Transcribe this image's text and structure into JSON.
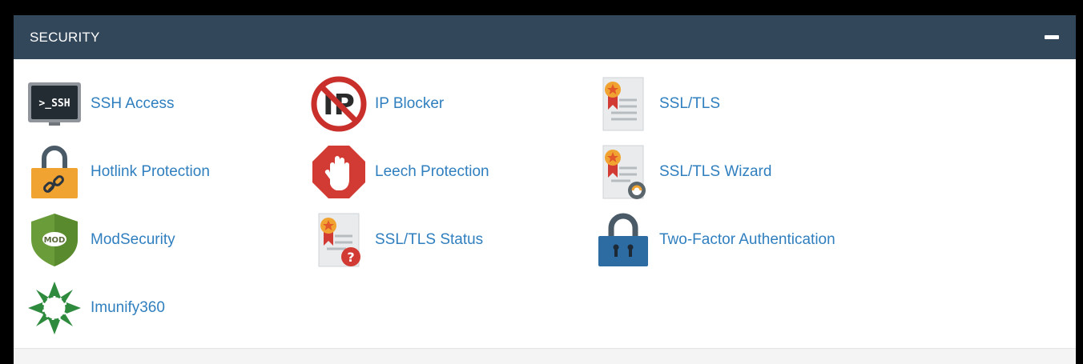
{
  "section": {
    "title": "SECURITY",
    "collapse_icon": "minus-icon"
  },
  "colors": {
    "header_bg": "#33475b",
    "link": "#2f7fbf"
  },
  "items": [
    {
      "label": "SSH Access",
      "icon": "ssh-terminal-icon"
    },
    {
      "label": "IP Blocker",
      "icon": "ip-blocker-icon"
    },
    {
      "label": "SSL/TLS",
      "icon": "certificate-icon"
    },
    {
      "label": "Hotlink Protection",
      "icon": "padlock-link-icon"
    },
    {
      "label": "Leech Protection",
      "icon": "stop-hand-icon"
    },
    {
      "label": "SSL/TLS Wizard",
      "icon": "certificate-wizard-icon"
    },
    {
      "label": "ModSecurity",
      "icon": "mod-shield-icon"
    },
    {
      "label": "SSL/TLS Status",
      "icon": "certificate-status-icon"
    },
    {
      "label": "Two-Factor Authentication",
      "icon": "two-factor-lock-icon"
    },
    {
      "label": "Imunify360",
      "icon": "imunify-star-icon"
    }
  ]
}
